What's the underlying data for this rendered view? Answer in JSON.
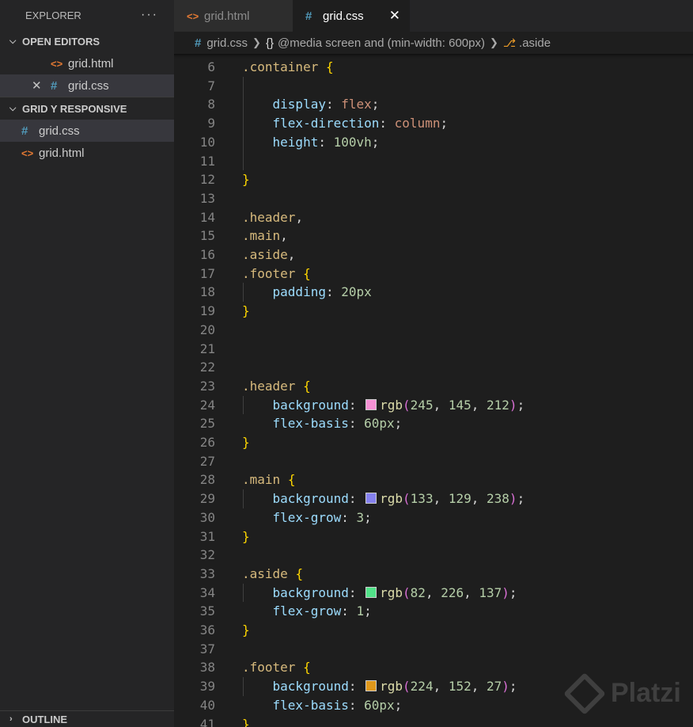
{
  "sidebar": {
    "title": "EXPLORER",
    "more": "···",
    "open_editors": {
      "label": "OPEN EDITORS",
      "items": [
        {
          "icon": "<>",
          "label": "grid.html"
        },
        {
          "icon": "#",
          "label": "grid.css",
          "close": "✕"
        }
      ]
    },
    "folder": {
      "label": "GRID Y RESPONSIVE",
      "items": [
        {
          "icon": "#",
          "label": "grid.css"
        },
        {
          "icon": "<>",
          "label": "grid.html"
        }
      ]
    },
    "outline": "OUTLINE"
  },
  "tabs": [
    {
      "icon": "<>",
      "label": "grid.html"
    },
    {
      "icon": "#",
      "label": "grid.css",
      "close": "✕"
    }
  ],
  "breadcrumb": {
    "file_icon": "#",
    "file": "grid.css",
    "braces": "{}",
    "media": "@media screen and (min-width: 600px)",
    "symbol": ".aside"
  },
  "editor": {
    "lines": [
      {
        "n": "6",
        "tokens": [
          {
            "t": ".container",
            "c": "sel"
          },
          {
            "t": " ",
            "c": "p"
          },
          {
            "t": "{",
            "c": "b1"
          }
        ]
      },
      {
        "n": "7",
        "tokens": []
      },
      {
        "n": "8",
        "tokens": [
          {
            "t": "    ",
            "c": "p"
          },
          {
            "t": "display",
            "c": "prop"
          },
          {
            "t": ": ",
            "c": "p"
          },
          {
            "t": "flex",
            "c": "val"
          },
          {
            "t": ";",
            "c": "p"
          }
        ]
      },
      {
        "n": "9",
        "tokens": [
          {
            "t": "    ",
            "c": "p"
          },
          {
            "t": "flex-direction",
            "c": "prop"
          },
          {
            "t": ": ",
            "c": "p"
          },
          {
            "t": "column",
            "c": "val"
          },
          {
            "t": ";",
            "c": "p"
          }
        ]
      },
      {
        "n": "10",
        "tokens": [
          {
            "t": "    ",
            "c": "p"
          },
          {
            "t": "height",
            "c": "prop"
          },
          {
            "t": ": ",
            "c": "p"
          },
          {
            "t": "100vh",
            "c": "num"
          },
          {
            "t": ";",
            "c": "p"
          }
        ]
      },
      {
        "n": "11",
        "tokens": []
      },
      {
        "n": "12",
        "tokens": [
          {
            "t": "}",
            "c": "b1"
          }
        ]
      },
      {
        "n": "13",
        "tokens": []
      },
      {
        "n": "14",
        "tokens": [
          {
            "t": ".header",
            "c": "sel"
          },
          {
            "t": ",",
            "c": "p"
          }
        ]
      },
      {
        "n": "15",
        "tokens": [
          {
            "t": ".main",
            "c": "sel"
          },
          {
            "t": ",",
            "c": "p"
          }
        ]
      },
      {
        "n": "16",
        "tokens": [
          {
            "t": ".aside",
            "c": "sel"
          },
          {
            "t": ",",
            "c": "p"
          }
        ]
      },
      {
        "n": "17",
        "tokens": [
          {
            "t": ".footer",
            "c": "sel"
          },
          {
            "t": " ",
            "c": "p"
          },
          {
            "t": "{",
            "c": "b1"
          }
        ]
      },
      {
        "n": "18",
        "tokens": [
          {
            "t": "    ",
            "c": "p"
          },
          {
            "t": "padding",
            "c": "prop"
          },
          {
            "t": ": ",
            "c": "p"
          },
          {
            "t": "20px",
            "c": "num"
          }
        ]
      },
      {
        "n": "19",
        "tokens": [
          {
            "t": "}",
            "c": "b1"
          }
        ]
      },
      {
        "n": "20",
        "tokens": []
      },
      {
        "n": "21",
        "tokens": []
      },
      {
        "n": "22",
        "tokens": []
      },
      {
        "n": "23",
        "tokens": [
          {
            "t": ".header",
            "c": "sel"
          },
          {
            "t": " ",
            "c": "p"
          },
          {
            "t": "{",
            "c": "b1"
          }
        ]
      },
      {
        "n": "24",
        "tokens": [
          {
            "t": "    ",
            "c": "p"
          },
          {
            "t": "background",
            "c": "prop"
          },
          {
            "t": ": ",
            "c": "p"
          },
          {
            "swatch": "#f591d4"
          },
          {
            "t": "rgb",
            "c": "fn"
          },
          {
            "t": "(",
            "c": "b2"
          },
          {
            "t": "245",
            "c": "num"
          },
          {
            "t": ", ",
            "c": "p"
          },
          {
            "t": "145",
            "c": "num"
          },
          {
            "t": ", ",
            "c": "p"
          },
          {
            "t": "212",
            "c": "num"
          },
          {
            "t": ")",
            "c": "b2"
          },
          {
            "t": ";",
            "c": "p"
          }
        ]
      },
      {
        "n": "25",
        "tokens": [
          {
            "t": "    ",
            "c": "p"
          },
          {
            "t": "flex-basis",
            "c": "prop"
          },
          {
            "t": ": ",
            "c": "p"
          },
          {
            "t": "60px",
            "c": "num"
          },
          {
            "t": ";",
            "c": "p"
          }
        ]
      },
      {
        "n": "26",
        "tokens": [
          {
            "t": "}",
            "c": "b1"
          }
        ]
      },
      {
        "n": "27",
        "tokens": []
      },
      {
        "n": "28",
        "tokens": [
          {
            "t": ".main",
            "c": "sel"
          },
          {
            "t": " ",
            "c": "p"
          },
          {
            "t": "{",
            "c": "b1"
          }
        ]
      },
      {
        "n": "29",
        "tokens": [
          {
            "t": "    ",
            "c": "p"
          },
          {
            "t": "background",
            "c": "prop"
          },
          {
            "t": ": ",
            "c": "p"
          },
          {
            "swatch": "#8581ee"
          },
          {
            "t": "rgb",
            "c": "fn"
          },
          {
            "t": "(",
            "c": "b2"
          },
          {
            "t": "133",
            "c": "num"
          },
          {
            "t": ", ",
            "c": "p"
          },
          {
            "t": "129",
            "c": "num"
          },
          {
            "t": ", ",
            "c": "p"
          },
          {
            "t": "238",
            "c": "num"
          },
          {
            "t": ")",
            "c": "b2"
          },
          {
            "t": ";",
            "c": "p"
          }
        ]
      },
      {
        "n": "30",
        "tokens": [
          {
            "t": "    ",
            "c": "p"
          },
          {
            "t": "flex-grow",
            "c": "prop"
          },
          {
            "t": ": ",
            "c": "p"
          },
          {
            "t": "3",
            "c": "num"
          },
          {
            "t": ";",
            "c": "p"
          }
        ]
      },
      {
        "n": "31",
        "tokens": [
          {
            "t": "}",
            "c": "b1"
          }
        ]
      },
      {
        "n": "32",
        "tokens": []
      },
      {
        "n": "33",
        "tokens": [
          {
            "t": ".aside",
            "c": "sel"
          },
          {
            "t": " ",
            "c": "p"
          },
          {
            "t": "{",
            "c": "b1"
          }
        ]
      },
      {
        "n": "34",
        "tokens": [
          {
            "t": "    ",
            "c": "p"
          },
          {
            "t": "background",
            "c": "prop"
          },
          {
            "t": ": ",
            "c": "p"
          },
          {
            "swatch": "#52e289"
          },
          {
            "t": "rgb",
            "c": "fn"
          },
          {
            "t": "(",
            "c": "b2"
          },
          {
            "t": "82",
            "c": "num"
          },
          {
            "t": ", ",
            "c": "p"
          },
          {
            "t": "226",
            "c": "num"
          },
          {
            "t": ", ",
            "c": "p"
          },
          {
            "t": "137",
            "c": "num"
          },
          {
            "t": ")",
            "c": "b2"
          },
          {
            "t": ";",
            "c": "p"
          }
        ]
      },
      {
        "n": "35",
        "tokens": [
          {
            "t": "    ",
            "c": "p"
          },
          {
            "t": "flex-grow",
            "c": "prop"
          },
          {
            "t": ": ",
            "c": "p"
          },
          {
            "t": "1",
            "c": "num"
          },
          {
            "t": ";",
            "c": "p"
          }
        ]
      },
      {
        "n": "36",
        "tokens": [
          {
            "t": "}",
            "c": "b1"
          }
        ]
      },
      {
        "n": "37",
        "tokens": []
      },
      {
        "n": "38",
        "tokens": [
          {
            "t": ".footer",
            "c": "sel"
          },
          {
            "t": " ",
            "c": "p"
          },
          {
            "t": "{",
            "c": "b1"
          }
        ]
      },
      {
        "n": "39",
        "tokens": [
          {
            "t": "    ",
            "c": "p"
          },
          {
            "t": "background",
            "c": "prop"
          },
          {
            "t": ": ",
            "c": "p"
          },
          {
            "swatch": "#e0981b"
          },
          {
            "t": "rgb",
            "c": "fn"
          },
          {
            "t": "(",
            "c": "b2"
          },
          {
            "t": "224",
            "c": "num"
          },
          {
            "t": ", ",
            "c": "p"
          },
          {
            "t": "152",
            "c": "num"
          },
          {
            "t": ", ",
            "c": "p"
          },
          {
            "t": "27",
            "c": "num"
          },
          {
            "t": ")",
            "c": "b2"
          },
          {
            "t": ";",
            "c": "p"
          }
        ]
      },
      {
        "n": "40",
        "tokens": [
          {
            "t": "    ",
            "c": "p"
          },
          {
            "t": "flex-basis",
            "c": "prop"
          },
          {
            "t": ": ",
            "c": "p"
          },
          {
            "t": "60px",
            "c": "num"
          },
          {
            "t": ";",
            "c": "p"
          }
        ]
      },
      {
        "n": "41",
        "tokens": [
          {
            "t": "}",
            "c": "b1"
          }
        ]
      }
    ]
  },
  "watermark": "Platzi"
}
